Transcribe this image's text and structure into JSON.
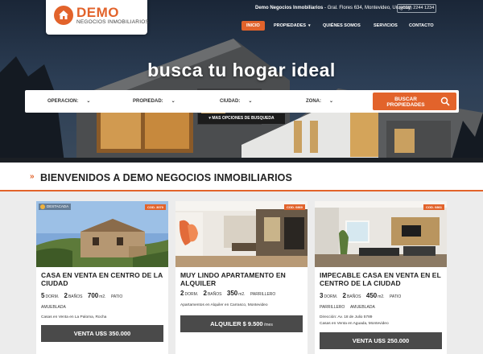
{
  "brand": {
    "name": "DEMO",
    "subtitle": "NEGOCIOS INMOBILIARIOS",
    "accent": "#e2632b"
  },
  "header": {
    "company": "Demo Negocios Inmobiliarios",
    "address": " - Gral. Flores 634, Montevideo, Uruguay",
    "phone": "(+598) 2244 1234"
  },
  "nav": {
    "items": [
      {
        "label": "INICIO",
        "active": true
      },
      {
        "label": "PROPIEDADES",
        "dropdown": true
      },
      {
        "label": "QUIÉNES SOMOS"
      },
      {
        "label": "SERVICIOS"
      },
      {
        "label": "CONTACTO"
      }
    ]
  },
  "hero": {
    "headline": "busca tu hogar ideal"
  },
  "search": {
    "fields": [
      {
        "label": "OPERACION:"
      },
      {
        "label": "PROPIEDAD:"
      },
      {
        "label": "CIUDAD:"
      },
      {
        "label": "ZONA:"
      }
    ],
    "button_line1": "BUSCAR",
    "button_line2": "PROPIEDADES",
    "more_options": "MAS OPCIONES DE BUSQUEDA"
  },
  "welcome": {
    "title": "BIENVENIDOS A DEMO NEGOCIOS INMOBILIARIOS"
  },
  "cards": [
    {
      "featured": "DESTACADA",
      "code": "COD. 3070",
      "title": "CASA EN VENTA EN CENTRO DE LA CIUDAD",
      "dorm": "5",
      "dorm_unit": "DORM.",
      "banos": "2",
      "banos_unit": "BAÑOS",
      "m2": "700",
      "m2_unit": "m2.",
      "extra1": "PATIO",
      "extra2": "AMUEBLADA",
      "direccion": "",
      "location": "Casas en Venta en La Paloma, Rocha",
      "price": "VENTA U$S 350.000",
      "price_suffix": ""
    },
    {
      "code": "COD. 0860",
      "title": "MUY LINDO APARTAMENTO EN ALQUILER",
      "dorm": "2",
      "dorm_unit": "DORM.",
      "banos": "2",
      "banos_unit": "BAÑOS",
      "m2": "350",
      "m2_unit": "m2.",
      "extra1": "PARRILLERO",
      "extra2": "",
      "direccion": "",
      "location": "Apartamentos en Alquiler en Carrasco, Montevideo",
      "price": "ALQUILER $ 9.500",
      "price_suffix": " /mes"
    },
    {
      "code": "COD. 0861",
      "title": "IMPECABLE CASA EN VENTA EN EL CENTRO DE LA CIUDAD",
      "dorm": "3",
      "dorm_unit": "DORM.",
      "banos": "2",
      "banos_unit": "BAÑOS",
      "m2": "450",
      "m2_unit": "m2.",
      "extra1": "PATIO",
      "extra2": "PARRILLERO     AMUEBLADA",
      "direccion": "Dirección: Av. 18 de Julio 5789",
      "location": "Casas en Venta en Aguada, Montevideo",
      "price": "VENTA U$S 250.000",
      "price_suffix": ""
    }
  ]
}
